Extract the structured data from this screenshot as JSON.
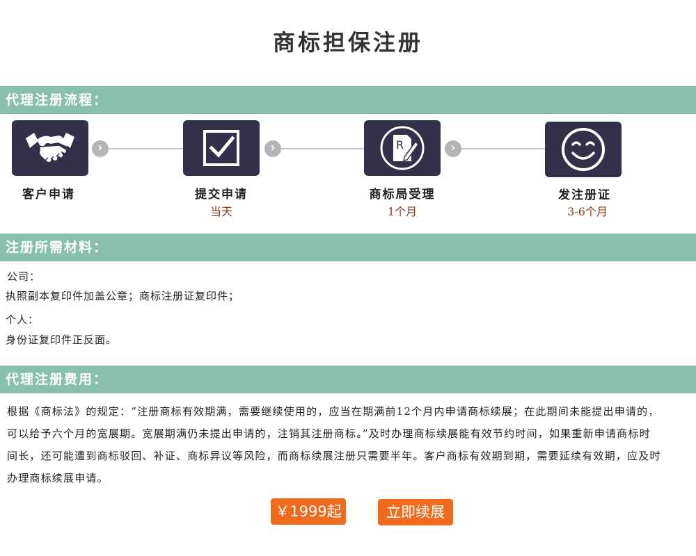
{
  "page": {
    "title": "商标担保注册"
  },
  "process": {
    "heading": "代理注册流程：",
    "steps": [
      {
        "name": "客户申请",
        "duration": "",
        "icon": "handshake-icon"
      },
      {
        "name": "提交申请",
        "duration": "当天",
        "icon": "checkbox-icon"
      },
      {
        "name": "商标局受理",
        "duration": "1个月",
        "icon": "registered-document-icon"
      },
      {
        "name": "发注册证",
        "duration": "3-6个月",
        "icon": "smiley-icon"
      }
    ]
  },
  "materials": {
    "heading": "注册所需材料：",
    "company_label": "公司：",
    "company_items": "执照副本复印件加盖公章；商标注册证复印件；",
    "individual_label": "个人：",
    "individual_items": "身份证复印件正反面。"
  },
  "fees": {
    "heading": "代理注册费用：",
    "description": "根据《商标法》的规定：“注册商标有效期满，需要继续使用的，应当在期满前12个月内申请商标续展；在此期间未能提出申请的，可以给予六个月的宽展期。宽展期满仍未提出申请的，注销其注册商标。”及时办理商标续展能有效节约时间，如果重新申请商标时间长，还可能遭到商标驳回、补证、商标异议等风险，而商标续展注册只需要半年。客户商标有效期到期，需要延续有效期，应及时办理商标续展申请。",
    "price_label": "￥1999起",
    "renew_label": "立即续展"
  },
  "colors": {
    "section_bar": "#88c0ad",
    "step_box": "#32304a",
    "duration_text": "#8b3a1a",
    "button": "#f26a1b"
  }
}
